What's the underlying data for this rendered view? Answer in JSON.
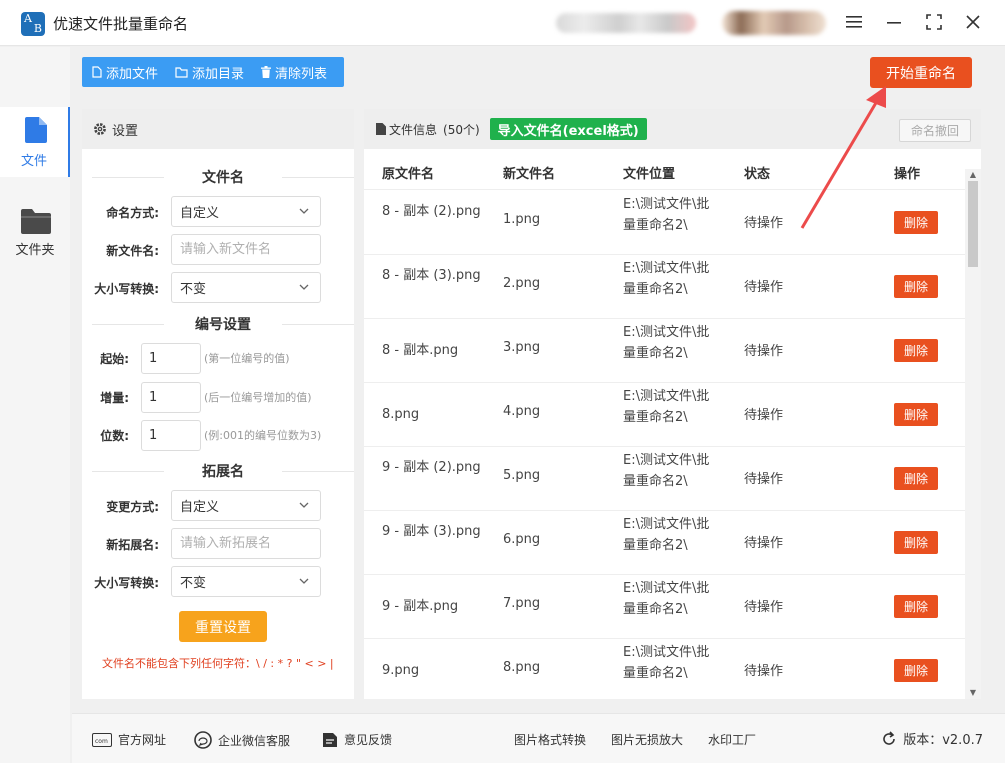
{
  "app": {
    "title": "优速文件批量重命名",
    "logo_a": "A",
    "logo_b": "B"
  },
  "window": {
    "menu_icon": "≡",
    "minimize_icon": "—",
    "maximize_icon": "⛶",
    "close_icon": "✕"
  },
  "nav": [
    {
      "label": "文件",
      "icon": "file-icon",
      "active": true
    },
    {
      "label": "文件夹",
      "icon": "folder-icon",
      "active": false
    }
  ],
  "toolbar": {
    "add_file": "添加文件",
    "add_dir": "添加目录",
    "clear_list": "清除列表",
    "start": "开始重命名"
  },
  "settings": {
    "header": "设置",
    "filename_section": "文件名",
    "naming_mode_label": "命名方式:",
    "naming_mode_value": "自定义",
    "new_name_label": "新文件名:",
    "new_name_placeholder": "请输入新文件名",
    "case_label": "大小写转换:",
    "case_value": "不变",
    "number_section": "编号设置",
    "start_label": "起始:",
    "start_value": "1",
    "start_hint": "(第一位编号的值)",
    "step_label": "增量:",
    "step_value": "1",
    "step_hint": "(后一位编号增加的值)",
    "digits_label": "位数:",
    "digits_value": "1",
    "digits_hint": "(例:001的编号位数为3)",
    "ext_section": "拓展名",
    "ext_mode_label": "变更方式:",
    "ext_mode_value": "自定义",
    "new_ext_label": "新拓展名:",
    "new_ext_placeholder": "请输入新拓展名",
    "ext_case_label": "大小写转换:",
    "ext_case_value": "不变",
    "reset": "重置设置",
    "warning": "文件名不能包含下列任何字符：\\ / : * ? \" < > |"
  },
  "files": {
    "header": "文件信息",
    "count": "(50个)",
    "import_btn": "导入文件名(excel格式)",
    "undo_btn": "命名撤回",
    "columns": [
      "原文件名",
      "新文件名",
      "文件位置",
      "状态",
      "操作"
    ],
    "rows": [
      {
        "orig": "8 - 副本 (2).png",
        "new": "1.png",
        "path": "E:\\测试文件\\批量重命名2\\",
        "status": "待操作",
        "action": "删除"
      },
      {
        "orig": "8 - 副本 (3).png",
        "new": "2.png",
        "path": "E:\\测试文件\\批量重命名2\\",
        "status": "待操作",
        "action": "删除"
      },
      {
        "orig": "8 - 副本.png",
        "new": "3.png",
        "path": "E:\\测试文件\\批量重命名2\\",
        "status": "待操作",
        "action": "删除"
      },
      {
        "orig": "8.png",
        "new": "4.png",
        "path": "E:\\测试文件\\批量重命名2\\",
        "status": "待操作",
        "action": "删除"
      },
      {
        "orig": "9 - 副本 (2).png",
        "new": "5.png",
        "path": "E:\\测试文件\\批量重命名2\\",
        "status": "待操作",
        "action": "删除"
      },
      {
        "orig": "9 - 副本 (3).png",
        "new": "6.png",
        "path": "E:\\测试文件\\批量重命名2\\",
        "status": "待操作",
        "action": "删除"
      },
      {
        "orig": "9 - 副本.png",
        "new": "7.png",
        "path": "E:\\测试文件\\批量重命名2\\",
        "status": "待操作",
        "action": "删除"
      },
      {
        "orig": "9.png",
        "new": "8.png",
        "path": "E:\\测试文件\\批量重命名2\\",
        "status": "待操作",
        "action": "删除"
      }
    ]
  },
  "footer": {
    "website": "官方网址",
    "wechat": "企业微信客服",
    "feedback": "意见反馈",
    "img_convert": "图片格式转换",
    "img_enlarge": "图片无损放大",
    "watermark": "水印工厂",
    "version": "版本：v2.0.7"
  },
  "colors": {
    "accent_blue": "#3b9cf3",
    "start_red": "#e9501f",
    "import_green": "#1fb14c",
    "reset_orange": "#f7a31c"
  }
}
